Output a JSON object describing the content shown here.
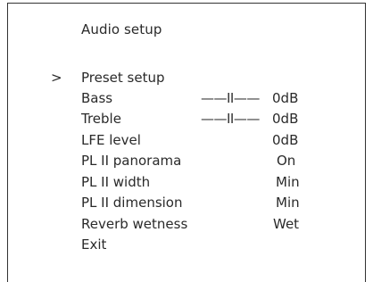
{
  "menu": {
    "title": "Audio setup",
    "cursor": ">",
    "items": [
      {
        "label": "Preset setup",
        "slider": "",
        "value": ""
      },
      {
        "label": "Bass",
        "slider": "——II——",
        "value": "0dB"
      },
      {
        "label": "Treble",
        "slider": "——II——",
        "value": "0dB"
      },
      {
        "label": "LFE level",
        "slider": "",
        "value": "0dB"
      },
      {
        "label": "PL II panorama",
        "slider": "",
        "value": "On"
      },
      {
        "label": "PL II width",
        "slider": "",
        "value": "Min"
      },
      {
        "label": "PL II dimension",
        "slider": "",
        "value": "Min"
      },
      {
        "label": "Reverb wetness",
        "slider": "",
        "value": "Wet"
      },
      {
        "label": "Exit",
        "slider": "",
        "value": ""
      }
    ]
  }
}
